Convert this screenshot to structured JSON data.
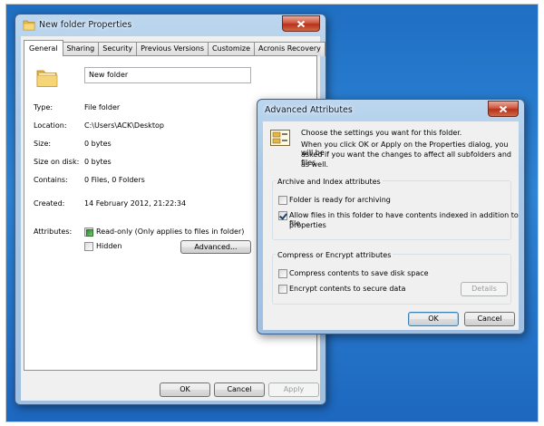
{
  "properties_window": {
    "title": "New folder Properties",
    "tabs": [
      "General",
      "Sharing",
      "Security",
      "Previous Versions",
      "Customize",
      "Acronis Recovery"
    ],
    "folder_name": "New folder",
    "rows": [
      {
        "label": "Type:",
        "value": "File folder"
      },
      {
        "label": "Location:",
        "value": "C:\\Users\\ACK\\Desktop"
      },
      {
        "label": "Size:",
        "value": "0 bytes"
      },
      {
        "label": "Size on disk:",
        "value": "0 bytes"
      },
      {
        "label": "Contains:",
        "value": "0 Files, 0 Folders"
      }
    ],
    "created_label": "Created:",
    "created_value": "14 February 2012, 21:22:34",
    "attributes_label": "Attributes:",
    "readonly_label": "Read-only (Only applies to files in folder)",
    "hidden_label": "Hidden",
    "advanced_button": "Advanced...",
    "ok_button": "OK",
    "cancel_button": "Cancel",
    "apply_button": "Apply"
  },
  "advanced_window": {
    "title": "Advanced Attributes",
    "intro_line1": "Choose the settings you want for this folder.",
    "intro_line2": "When you click OK or Apply on the Properties dialog, you will be",
    "intro_line3": "asked if you want the changes to affect all subfolders and files",
    "intro_line4": "as well.",
    "archive_group_label": "Archive and Index attributes",
    "archive_checkbox": "Folder is ready for archiving",
    "index_checkbox_line1": "Allow files in this folder to have contents indexed in addition to file",
    "index_checkbox_line2": "properties",
    "compress_group_label": "Compress or Encrypt attributes",
    "compress_checkbox": "Compress contents to save disk space",
    "encrypt_checkbox": "Encrypt contents to secure data",
    "details_button": "Details",
    "ok_button": "OK",
    "cancel_button": "Cancel"
  }
}
